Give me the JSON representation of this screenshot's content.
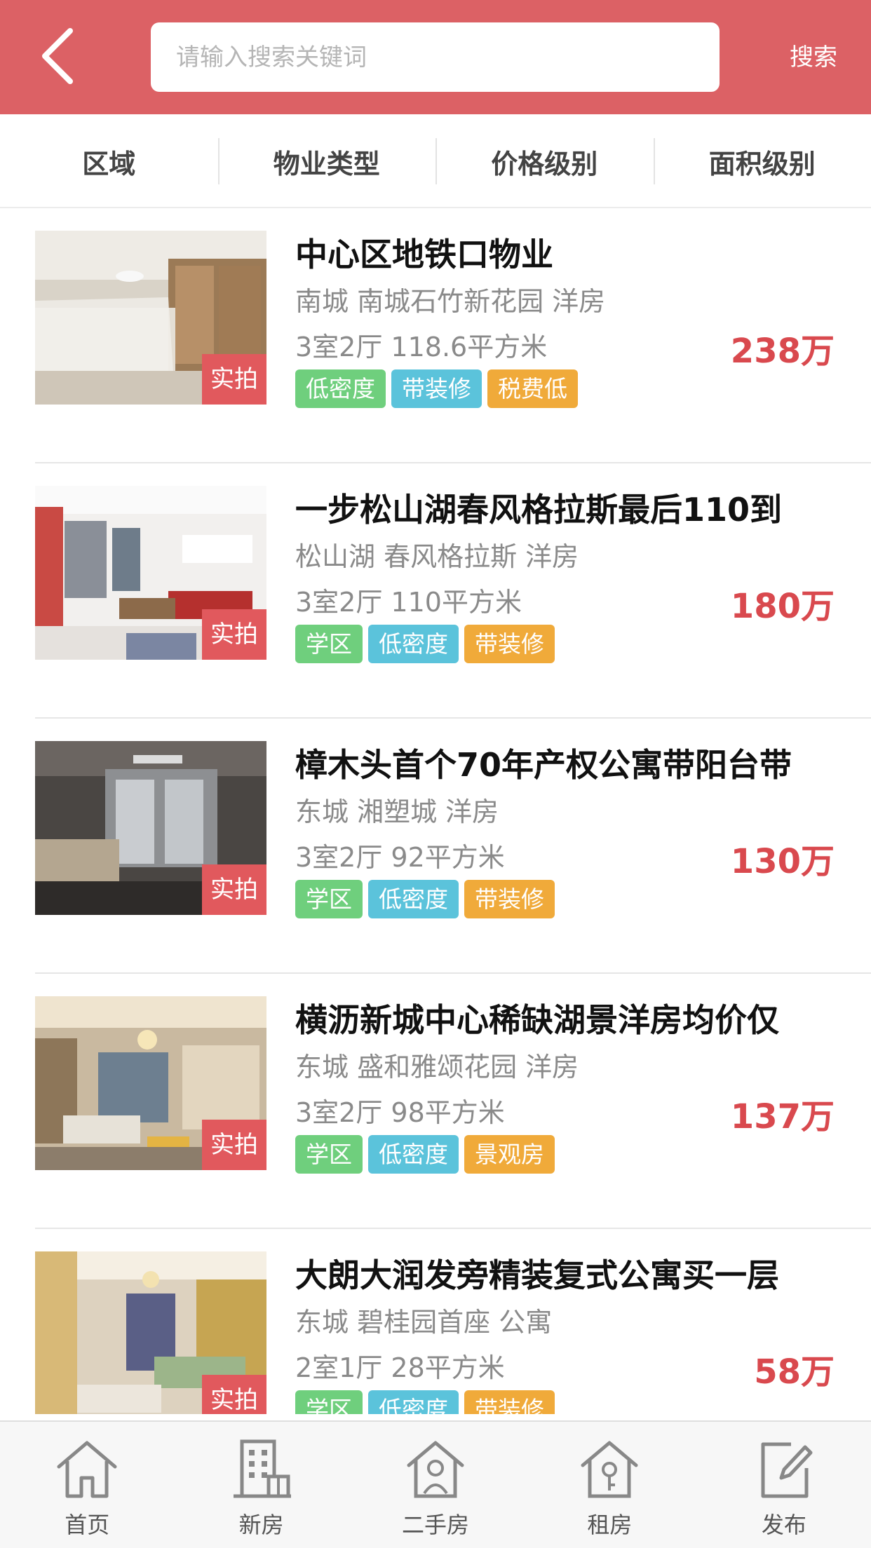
{
  "header": {
    "search_placeholder": "请输入搜索关键词",
    "search_button": "搜索"
  },
  "filters": [
    {
      "label": "区域"
    },
    {
      "label": "物业类型"
    },
    {
      "label": "价格级别"
    },
    {
      "label": "面积级别"
    }
  ],
  "photo_badge": "实拍",
  "listings": [
    {
      "title": "中心区地铁口物业",
      "location": "南城 南城石竹新花园 洋房",
      "specs": "3室2厅 118.6平方米",
      "price": "238万",
      "tags": [
        {
          "text": "低密度",
          "color": "green"
        },
        {
          "text": "带装修",
          "color": "blue"
        },
        {
          "text": "税费低",
          "color": "orange"
        }
      ]
    },
    {
      "title": "一步松山湖春风格拉斯最后110到",
      "location": "松山湖 春风格拉斯 洋房",
      "specs": "3室2厅 110平方米",
      "price": "180万",
      "tags": [
        {
          "text": "学区",
          "color": "green"
        },
        {
          "text": "低密度",
          "color": "blue"
        },
        {
          "text": "带装修",
          "color": "orange"
        }
      ]
    },
    {
      "title": "樟木头首个70年产权公寓带阳台带",
      "location": "东城 湘塑城 洋房",
      "specs": "3室2厅 92平方米",
      "price": "130万",
      "tags": [
        {
          "text": "学区",
          "color": "green"
        },
        {
          "text": "低密度",
          "color": "blue"
        },
        {
          "text": "带装修",
          "color": "orange"
        }
      ]
    },
    {
      "title": "横沥新城中心稀缺湖景洋房均价仅",
      "location": "东城 盛和雅颂花园 洋房",
      "specs": "3室2厅 98平方米",
      "price": "137万",
      "tags": [
        {
          "text": "学区",
          "color": "green"
        },
        {
          "text": "低密度",
          "color": "blue"
        },
        {
          "text": "景观房",
          "color": "orange"
        }
      ]
    },
    {
      "title": "大朗大润发旁精装复式公寓买一层",
      "location": "东城 碧桂园首座 公寓",
      "specs": "2室1厅 28平方米",
      "price": "58万",
      "tags": [
        {
          "text": "学区",
          "color": "green"
        },
        {
          "text": "低密度",
          "color": "blue"
        },
        {
          "text": "带装修",
          "color": "orange"
        }
      ]
    }
  ],
  "tabbar": [
    {
      "label": "首页",
      "icon": "home-icon"
    },
    {
      "label": "新房",
      "icon": "building-icon"
    },
    {
      "label": "二手房",
      "icon": "house-person-icon"
    },
    {
      "label": "租房",
      "icon": "house-key-icon"
    },
    {
      "label": "发布",
      "icon": "edit-icon"
    }
  ],
  "colors": {
    "header_bg": "#dc6165",
    "price": "#d9494e",
    "tag_green": "#6fcf7d",
    "tag_blue": "#5bc3db",
    "tag_orange": "#f0aa3a"
  }
}
